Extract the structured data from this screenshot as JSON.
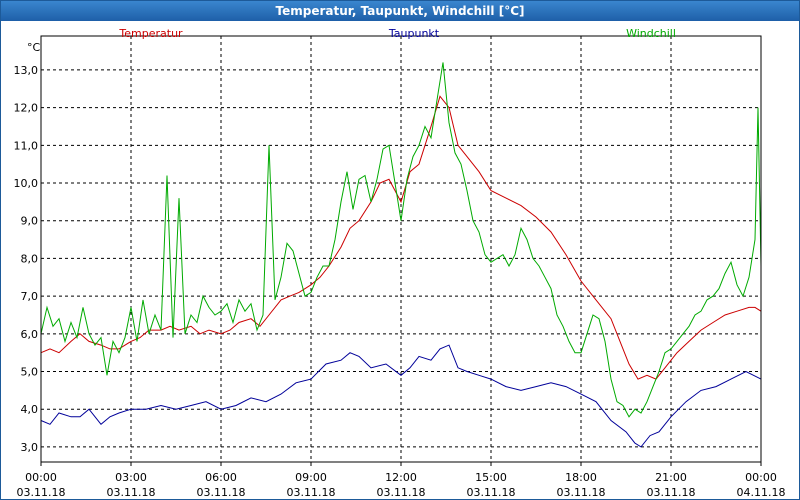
{
  "window": {
    "title": "Temperatur, Taupunkt, Windchill [°C]"
  },
  "chart_data": {
    "type": "line",
    "title": "Temperatur, Taupunkt, Windchill [°C]",
    "ylabel": "°C",
    "ylim": [
      2.6,
      13.9
    ],
    "xlim": [
      0,
      24
    ],
    "yticks": [
      "3,0",
      "4,0",
      "5,0",
      "6,0",
      "7,0",
      "8,0",
      "9,0",
      "10,0",
      "11,0",
      "12,0",
      "13,0"
    ],
    "ytick_values": [
      3,
      4,
      5,
      6,
      7,
      8,
      9,
      10,
      11,
      12,
      13
    ],
    "xticks": [
      {
        "time": "00:00",
        "date": "03.11.18"
      },
      {
        "time": "03:00",
        "date": "03.11.18"
      },
      {
        "time": "06:00",
        "date": "03.11.18"
      },
      {
        "time": "09:00",
        "date": "03.11.18"
      },
      {
        "time": "12:00",
        "date": "03.11.18"
      },
      {
        "time": "15:00",
        "date": "03.11.18"
      },
      {
        "time": "18:00",
        "date": "03.11.18"
      },
      {
        "time": "21:00",
        "date": "03.11.18"
      },
      {
        "time": "00:00",
        "date": "04.11.18"
      }
    ],
    "grid": true,
    "legend_position": "top",
    "series": [
      {
        "name": "Temperatur",
        "color": "#cc0000",
        "points": [
          [
            0,
            5.5
          ],
          [
            0.3,
            5.6
          ],
          [
            0.6,
            5.5
          ],
          [
            1,
            5.8
          ],
          [
            1.3,
            6.0
          ],
          [
            1.6,
            5.8
          ],
          [
            2,
            5.7
          ],
          [
            2.3,
            5.6
          ],
          [
            2.6,
            5.6
          ],
          [
            3,
            5.8
          ],
          [
            3.3,
            5.9
          ],
          [
            3.6,
            6.1
          ],
          [
            4,
            6.1
          ],
          [
            4.3,
            6.2
          ],
          [
            4.6,
            6.1
          ],
          [
            5,
            6.2
          ],
          [
            5.3,
            6.0
          ],
          [
            5.6,
            6.1
          ],
          [
            6,
            6.0
          ],
          [
            6.3,
            6.1
          ],
          [
            6.6,
            6.3
          ],
          [
            7,
            6.4
          ],
          [
            7.3,
            6.2
          ],
          [
            7.6,
            6.5
          ],
          [
            8,
            6.9
          ],
          [
            8.3,
            7.0
          ],
          [
            8.6,
            7.1
          ],
          [
            9,
            7.3
          ],
          [
            9.3,
            7.5
          ],
          [
            9.6,
            7.8
          ],
          [
            10,
            8.3
          ],
          [
            10.3,
            8.8
          ],
          [
            10.6,
            9.0
          ],
          [
            11,
            9.5
          ],
          [
            11.3,
            10.0
          ],
          [
            11.6,
            10.1
          ],
          [
            12,
            9.5
          ],
          [
            12.3,
            10.3
          ],
          [
            12.6,
            10.5
          ],
          [
            13,
            11.5
          ],
          [
            13.3,
            12.3
          ],
          [
            13.6,
            12.0
          ],
          [
            13.9,
            11.0
          ],
          [
            14.2,
            10.7
          ],
          [
            14.6,
            10.3
          ],
          [
            15,
            9.8
          ],
          [
            15.5,
            9.6
          ],
          [
            16,
            9.4
          ],
          [
            16.5,
            9.1
          ],
          [
            17,
            8.7
          ],
          [
            17.5,
            8.1
          ],
          [
            18,
            7.4
          ],
          [
            18.5,
            6.9
          ],
          [
            19,
            6.4
          ],
          [
            19.3,
            5.8
          ],
          [
            19.6,
            5.2
          ],
          [
            19.9,
            4.8
          ],
          [
            20.2,
            4.9
          ],
          [
            20.5,
            4.8
          ],
          [
            20.8,
            5.1
          ],
          [
            21.2,
            5.5
          ],
          [
            21.6,
            5.8
          ],
          [
            22,
            6.1
          ],
          [
            22.4,
            6.3
          ],
          [
            22.8,
            6.5
          ],
          [
            23.2,
            6.6
          ],
          [
            23.6,
            6.7
          ],
          [
            23.8,
            6.7
          ],
          [
            24,
            6.6
          ]
        ]
      },
      {
        "name": "Taupunkt",
        "color": "#000099",
        "points": [
          [
            0,
            3.7
          ],
          [
            0.3,
            3.6
          ],
          [
            0.6,
            3.9
          ],
          [
            1,
            3.8
          ],
          [
            1.3,
            3.8
          ],
          [
            1.6,
            4.0
          ],
          [
            2,
            3.6
          ],
          [
            2.3,
            3.8
          ],
          [
            2.6,
            3.9
          ],
          [
            3,
            4.0
          ],
          [
            3.5,
            4.0
          ],
          [
            4,
            4.1
          ],
          [
            4.5,
            4.0
          ],
          [
            5,
            4.1
          ],
          [
            5.5,
            4.2
          ],
          [
            6,
            4.0
          ],
          [
            6.5,
            4.1
          ],
          [
            7,
            4.3
          ],
          [
            7.5,
            4.2
          ],
          [
            8,
            4.4
          ],
          [
            8.5,
            4.7
          ],
          [
            9,
            4.8
          ],
          [
            9.5,
            5.2
          ],
          [
            10,
            5.3
          ],
          [
            10.3,
            5.5
          ],
          [
            10.6,
            5.4
          ],
          [
            11,
            5.1
          ],
          [
            11.5,
            5.2
          ],
          [
            12,
            4.9
          ],
          [
            12.3,
            5.1
          ],
          [
            12.6,
            5.4
          ],
          [
            13,
            5.3
          ],
          [
            13.3,
            5.6
          ],
          [
            13.6,
            5.7
          ],
          [
            13.9,
            5.1
          ],
          [
            14.2,
            5.0
          ],
          [
            14.6,
            4.9
          ],
          [
            15,
            4.8
          ],
          [
            15.5,
            4.6
          ],
          [
            16,
            4.5
          ],
          [
            16.5,
            4.6
          ],
          [
            17,
            4.7
          ],
          [
            17.5,
            4.6
          ],
          [
            18,
            4.4
          ],
          [
            18.5,
            4.2
          ],
          [
            19,
            3.7
          ],
          [
            19.5,
            3.4
          ],
          [
            19.8,
            3.1
          ],
          [
            20,
            3.0
          ],
          [
            20.3,
            3.3
          ],
          [
            20.6,
            3.4
          ],
          [
            21,
            3.8
          ],
          [
            21.5,
            4.2
          ],
          [
            22,
            4.5
          ],
          [
            22.5,
            4.6
          ],
          [
            23,
            4.8
          ],
          [
            23.5,
            5.0
          ],
          [
            24,
            4.8
          ]
        ]
      },
      {
        "name": "Windchill",
        "color": "#00aa00",
        "points": [
          [
            0,
            6.0
          ],
          [
            0.2,
            6.7
          ],
          [
            0.4,
            6.2
          ],
          [
            0.6,
            6.4
          ],
          [
            0.8,
            5.8
          ],
          [
            1,
            6.3
          ],
          [
            1.2,
            5.9
          ],
          [
            1.4,
            6.7
          ],
          [
            1.6,
            6.0
          ],
          [
            1.8,
            5.7
          ],
          [
            2,
            5.9
          ],
          [
            2.2,
            4.9
          ],
          [
            2.4,
            5.8
          ],
          [
            2.6,
            5.5
          ],
          [
            2.8,
            5.9
          ],
          [
            3,
            6.7
          ],
          [
            3.2,
            5.8
          ],
          [
            3.4,
            6.9
          ],
          [
            3.6,
            6.0
          ],
          [
            3.8,
            6.5
          ],
          [
            4,
            6.1
          ],
          [
            4.2,
            10.2
          ],
          [
            4.4,
            5.9
          ],
          [
            4.6,
            9.6
          ],
          [
            4.8,
            6.0
          ],
          [
            5,
            6.5
          ],
          [
            5.2,
            6.3
          ],
          [
            5.4,
            7.0
          ],
          [
            5.6,
            6.7
          ],
          [
            5.8,
            6.5
          ],
          [
            6,
            6.6
          ],
          [
            6.2,
            6.8
          ],
          [
            6.4,
            6.3
          ],
          [
            6.6,
            6.9
          ],
          [
            6.8,
            6.6
          ],
          [
            7,
            6.8
          ],
          [
            7.2,
            6.1
          ],
          [
            7.4,
            6.5
          ],
          [
            7.6,
            11.0
          ],
          [
            7.8,
            6.9
          ],
          [
            8,
            7.5
          ],
          [
            8.2,
            8.4
          ],
          [
            8.4,
            8.2
          ],
          [
            8.6,
            7.6
          ],
          [
            8.8,
            7.0
          ],
          [
            9,
            7.1
          ],
          [
            9.2,
            7.5
          ],
          [
            9.4,
            7.8
          ],
          [
            9.6,
            7.8
          ],
          [
            9.8,
            8.5
          ],
          [
            10,
            9.5
          ],
          [
            10.2,
            10.3
          ],
          [
            10.4,
            9.3
          ],
          [
            10.6,
            10.1
          ],
          [
            10.8,
            10.2
          ],
          [
            11,
            9.5
          ],
          [
            11.2,
            10.1
          ],
          [
            11.4,
            10.9
          ],
          [
            11.6,
            11.0
          ],
          [
            11.8,
            10.0
          ],
          [
            12,
            9.0
          ],
          [
            12.2,
            10.1
          ],
          [
            12.4,
            10.7
          ],
          [
            12.6,
            11.0
          ],
          [
            12.8,
            11.5
          ],
          [
            13,
            11.2
          ],
          [
            13.2,
            12.2
          ],
          [
            13.4,
            13.2
          ],
          [
            13.6,
            11.6
          ],
          [
            13.8,
            10.8
          ],
          [
            14,
            10.5
          ],
          [
            14.2,
            9.8
          ],
          [
            14.4,
            9.0
          ],
          [
            14.6,
            8.7
          ],
          [
            14.8,
            8.1
          ],
          [
            15,
            7.9
          ],
          [
            15.2,
            8.0
          ],
          [
            15.4,
            8.1
          ],
          [
            15.6,
            7.8
          ],
          [
            15.8,
            8.1
          ],
          [
            16,
            8.8
          ],
          [
            16.2,
            8.5
          ],
          [
            16.4,
            8.0
          ],
          [
            16.6,
            7.8
          ],
          [
            16.8,
            7.5
          ],
          [
            17,
            7.2
          ],
          [
            17.2,
            6.5
          ],
          [
            17.4,
            6.2
          ],
          [
            17.6,
            5.8
          ],
          [
            17.8,
            5.5
          ],
          [
            18,
            5.5
          ],
          [
            18.2,
            6.0
          ],
          [
            18.4,
            6.5
          ],
          [
            18.6,
            6.4
          ],
          [
            18.8,
            5.8
          ],
          [
            19,
            4.8
          ],
          [
            19.2,
            4.2
          ],
          [
            19.4,
            4.1
          ],
          [
            19.6,
            3.8
          ],
          [
            19.8,
            4.0
          ],
          [
            20,
            3.9
          ],
          [
            20.2,
            4.2
          ],
          [
            20.4,
            4.6
          ],
          [
            20.6,
            5.0
          ],
          [
            20.8,
            5.5
          ],
          [
            21,
            5.6
          ],
          [
            21.2,
            5.8
          ],
          [
            21.4,
            6.0
          ],
          [
            21.6,
            6.2
          ],
          [
            21.8,
            6.5
          ],
          [
            22,
            6.6
          ],
          [
            22.2,
            6.9
          ],
          [
            22.4,
            7.0
          ],
          [
            22.6,
            7.2
          ],
          [
            22.8,
            7.6
          ],
          [
            23,
            7.9
          ],
          [
            23.2,
            7.3
          ],
          [
            23.4,
            7.0
          ],
          [
            23.6,
            7.5
          ],
          [
            23.8,
            8.5
          ],
          [
            23.9,
            12.0
          ],
          [
            24,
            7.8
          ]
        ]
      }
    ]
  }
}
